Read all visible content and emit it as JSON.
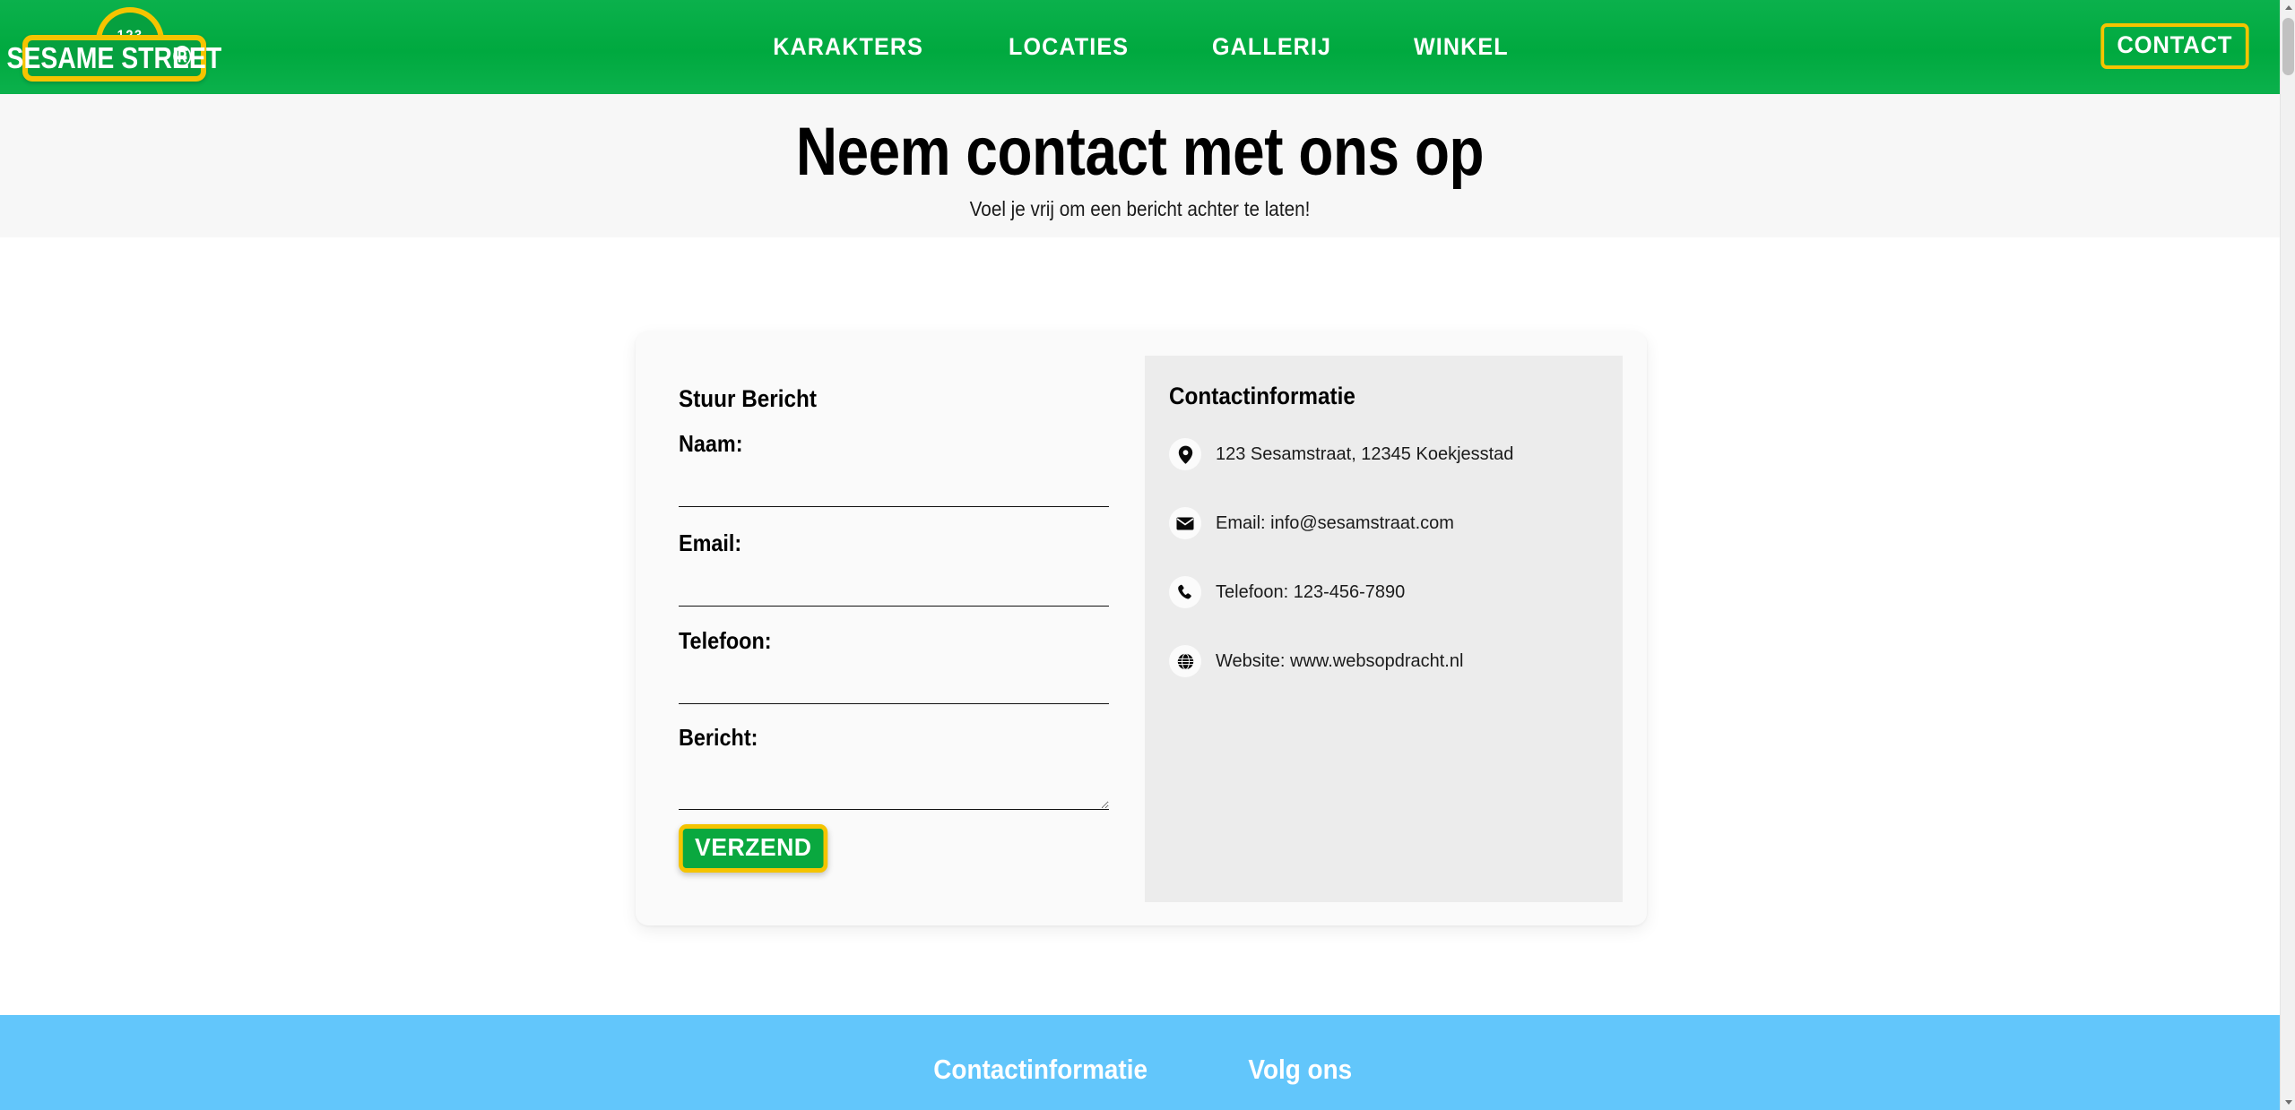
{
  "header": {
    "logo": {
      "number": "123",
      "name": "SESAME STREET",
      "registered_mark": "®",
      "sign_green": "#06a03f",
      "sign_yellow": "#f5c400"
    },
    "nav_items": [
      {
        "label": "KARAKTERS"
      },
      {
        "label": "LOCATIES"
      },
      {
        "label": "GALLERIJ"
      },
      {
        "label": "WINKEL"
      }
    ],
    "contact_button": "CONTACT",
    "bar_color": "#00a93f"
  },
  "hero": {
    "title": "Neem contact met ons op",
    "subtitle": "Voel je vrij om een bericht achter te laten!",
    "background": "#f7f7f7"
  },
  "form": {
    "title": "Stuur Bericht",
    "fields": [
      {
        "label": "Naam:",
        "value": "",
        "placeholder": ""
      },
      {
        "label": "Email:",
        "value": "",
        "placeholder": ""
      },
      {
        "label": "Telefoon:",
        "value": "",
        "placeholder": ""
      },
      {
        "label": "Bericht:",
        "value": "",
        "placeholder": ""
      }
    ],
    "submit_label": "VERZEND",
    "submit_bg": "#0aa83f",
    "submit_border": "#f5c400"
  },
  "info": {
    "title": "Contactinformatie",
    "panel_bg": "#ececec",
    "items": [
      {
        "icon": "map-pin-icon",
        "text": "123 Sesamstraat, 12345 Koekjesstad"
      },
      {
        "icon": "envelope-icon",
        "text": "Email: info@sesamstraat.com"
      },
      {
        "icon": "phone-icon",
        "text": "Telefoon: 123-456-7890"
      },
      {
        "icon": "globe-icon",
        "text": "Website: www.websopdracht.nl"
      }
    ]
  },
  "footer": {
    "background": "#62c6fb",
    "columns": [
      {
        "heading": "Contactinformatie"
      },
      {
        "heading": "Volg ons"
      }
    ]
  }
}
